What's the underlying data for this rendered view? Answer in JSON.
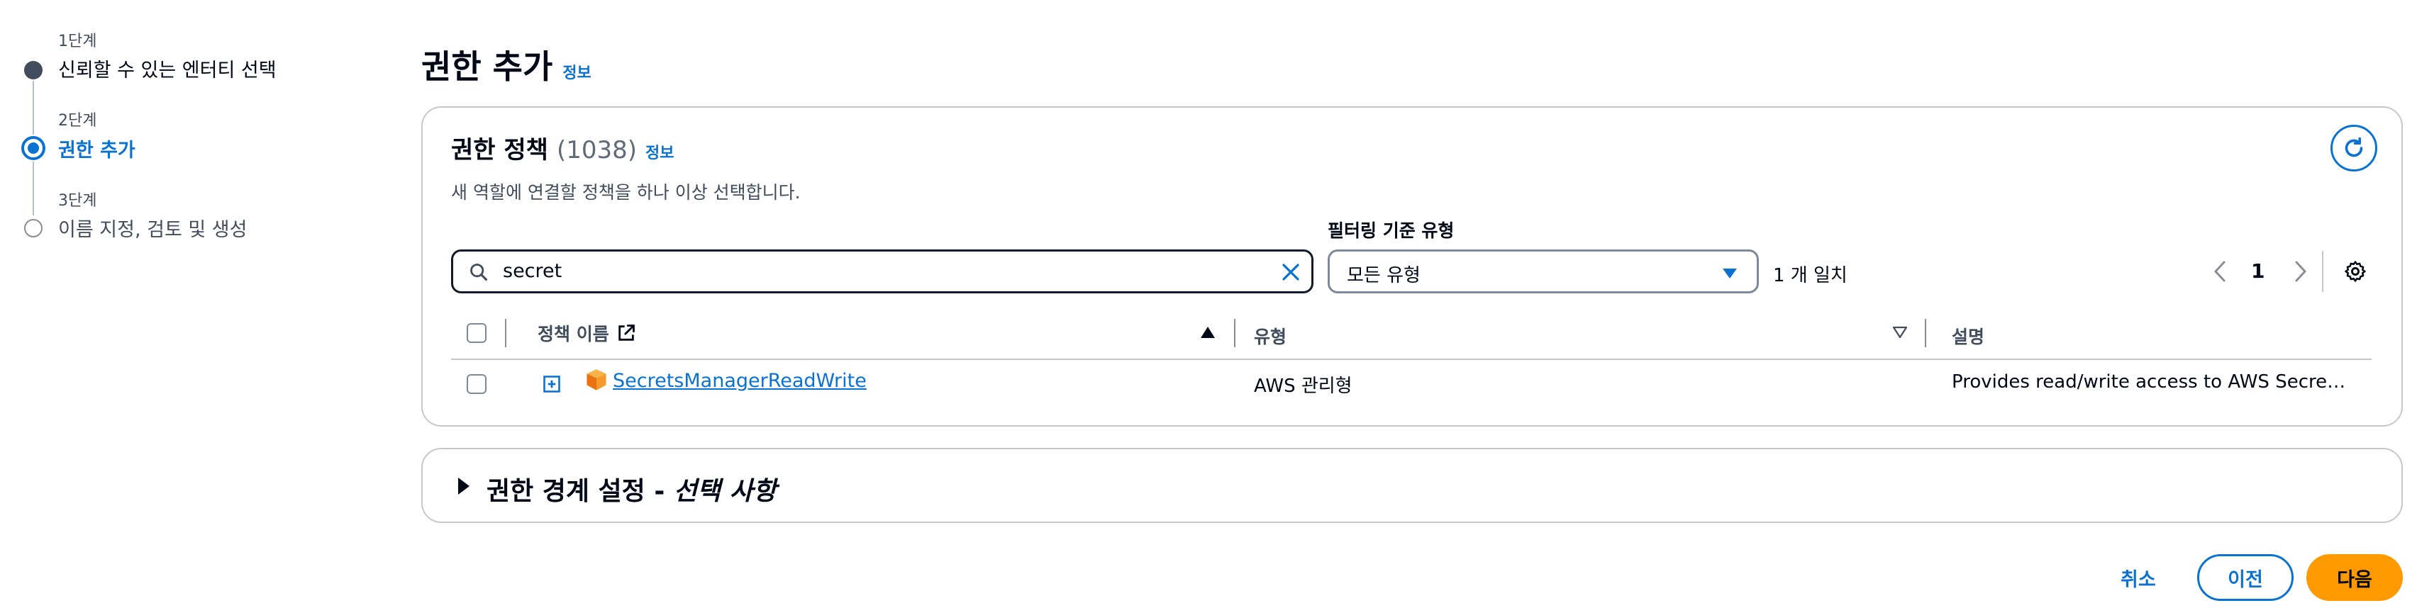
{
  "wizard": {
    "steps": [
      {
        "number": "1단계",
        "label": "신뢰할 수 있는 엔터티 선택"
      },
      {
        "number": "2단계",
        "label": "권한 추가"
      },
      {
        "number": "3단계",
        "label": "이름 지정, 검토 및 생성"
      }
    ]
  },
  "page": {
    "title": "권한 추가",
    "info": "정보"
  },
  "policies": {
    "title": "권한 정책",
    "count": "(1038)",
    "info": "정보",
    "description": "새 역할에 연결할 정책을 하나 이상 선택합니다.",
    "search": {
      "value": "secret"
    },
    "filter": {
      "label": "필터링 기준 유형",
      "selected": "모든 유형"
    },
    "match_count": "1 개 일치",
    "pagination": {
      "current": "1"
    },
    "columns": {
      "name": "정책 이름",
      "type": "유형",
      "description": "설명"
    },
    "rows": [
      {
        "name": "SecretsManagerReadWrite",
        "type": "AWS 관리형",
        "description": "Provides read/write access to AWS Secre…"
      }
    ]
  },
  "boundary": {
    "title": "권한 경계 설정 - ",
    "title_italic": "선택 사항"
  },
  "footer": {
    "cancel": "취소",
    "previous": "이전",
    "next": "다음"
  },
  "colors": {
    "accent": "#0972d3",
    "primary_button": "#ff9900",
    "text": "#000716"
  }
}
